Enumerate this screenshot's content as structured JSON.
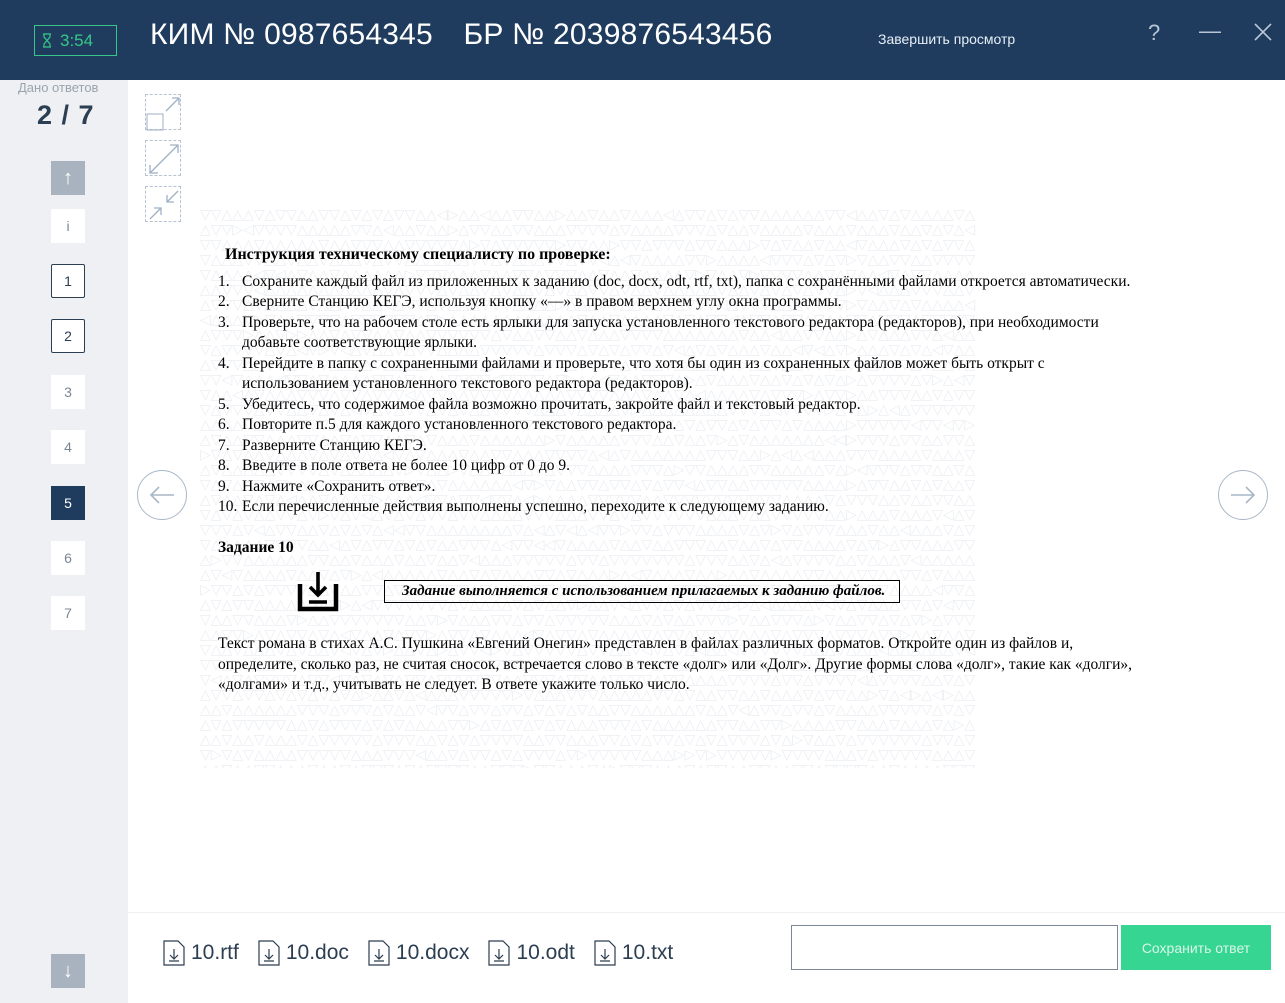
{
  "titlebar": {
    "timer": "3:54",
    "kim": "КИМ № 0987654345",
    "br": "БР № 2039876543456",
    "finish_label": "Завершить просмотр",
    "help": "?",
    "minimize": "—",
    "close": "✕"
  },
  "sidebar": {
    "answered_label": "Дано ответов",
    "answered_count": "2 / 7",
    "up": "↑",
    "down": "↓",
    "items": [
      "i",
      "1",
      "2",
      "3",
      "4",
      "5",
      "6",
      "7"
    ],
    "active_item": "5"
  },
  "doc": {
    "instr_title": "Инструкция техническому специалисту по проверке:",
    "steps": [
      {
        "n": "1.",
        "t": "Сохраните каждый файл из приложенных к заданию (doc, docx, odt, rtf, txt), папка с сохранёнными файлами откроется автоматически."
      },
      {
        "n": "2.",
        "t": "Сверните Станцию КЕГЭ, используя кнопку «—» в правом верхнем углу окна программы."
      },
      {
        "n": "3.",
        "t": "Проверьте, что на рабочем столе есть ярлыки для запуска установленного текстового редактора (редакторов), при необходимости добавьте соответствующие ярлыки."
      },
      {
        "n": "4.",
        "t": "Перейдите в папку с сохраненными файлами и проверьте, что хотя бы один из сохраненных файлов может быть открыт с использованием установленного текстового редактора (редакторов)."
      },
      {
        "n": "5.",
        "t": "Убедитесь, что содержимое файла возможно прочитать, закройте файл и текстовый редактор."
      },
      {
        "n": "6.",
        "t": "Повторите п.5 для каждого установленного текстового редактора."
      },
      {
        "n": "7.",
        "t": "Разверните Станцию КЕГЭ."
      },
      {
        "n": "8.",
        "t": "Введите в поле ответа не более 10 цифр от 0 до 9."
      },
      {
        "n": "9.",
        "t": "Нажмите «Сохранить ответ»."
      },
      {
        "n": "10.",
        "t": "Если перечисленные действия выполнены успешно, переходите к следующему заданию."
      }
    ],
    "task_title": "Задание 10",
    "file_note": "Задание выполняется с использованием прилагаемых к заданию файлов.",
    "task_text": "Текст романа в стихах А.С. Пушкина «Евгений Онегин» представлен в файлах различных форматов. Откройте один из файлов и, определите, сколько раз, не считая сносок, встречается слово в тексте «долг» или «Долг». Другие формы слова «долг», такие как «долги», «долгами» и т.д., учитывать не следует. В ответе укажите только число."
  },
  "files": [
    "10.rtf",
    "10.doc",
    "10.docx",
    "10.odt",
    "10.txt"
  ],
  "answer": {
    "value": "",
    "save_label": "Сохранить ответ"
  },
  "colors": {
    "titlebar": "#1f3c5e",
    "accent_green": "#37d592",
    "timer_green": "#37c788"
  }
}
